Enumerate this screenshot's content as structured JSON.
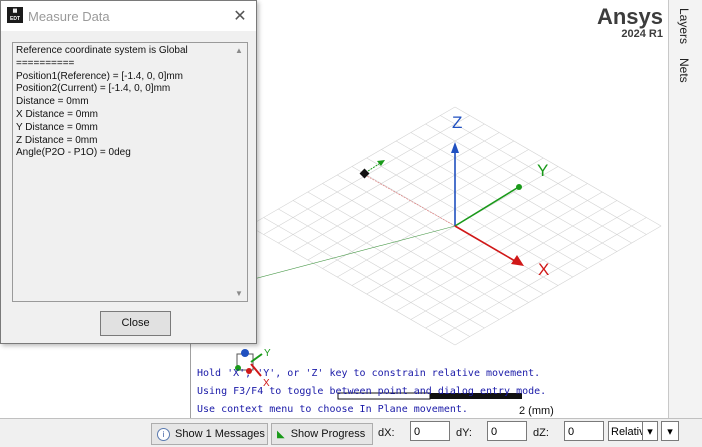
{
  "dialog": {
    "title": "Measure Data",
    "lines": [
      "Reference coordinate system is Global",
      "==========",
      "Position1(Reference) = [-1.4, 0, 0]mm",
      "Position2(Current) = [-1.4, 0, 0]mm",
      "Distance = 0mm",
      "X Distance = 0mm",
      "Y Distance = 0mm",
      "Z Distance = 0mm",
      "Angle(P2O - P1O) = 0deg"
    ],
    "close_label": "Close"
  },
  "brand": {
    "name": "Ansys",
    "version": "2024 R1"
  },
  "side_tabs": [
    "Layers",
    "Nets"
  ],
  "axes": {
    "x": "X",
    "y": "Y",
    "z": "Z"
  },
  "hints": [
    "Hold 'X', 'Y', or 'Z' key to constrain relative movement.",
    "Using F3/F4 to toggle between point and dialog entry mode.",
    "Use context menu to choose In Plane movement."
  ],
  "scale_label": "2 (mm)",
  "statusbar": {
    "messages_label": "Show 1 Messages",
    "progress_label": "Show Progress",
    "dx_label": "dX:",
    "dx_value": "0",
    "dy_label": "dY:",
    "dy_value": "0",
    "dz_label": "dZ:",
    "dz_value": "0",
    "mode_value": "Relative"
  },
  "colors": {
    "x_axis": "#d01818",
    "y_axis": "#1a9a1a",
    "z_axis": "#2050c0",
    "hint_text": "#1a1aa8"
  }
}
